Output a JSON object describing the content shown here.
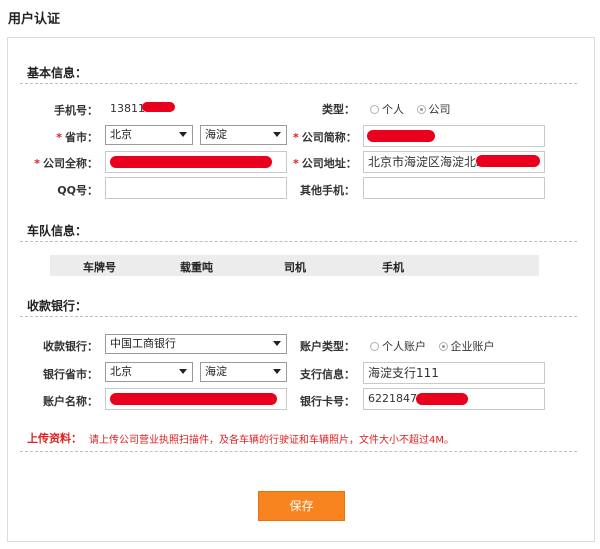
{
  "page_title": "用户认证",
  "basic": {
    "section_title": "基本信息：",
    "phone_label": "手机号：",
    "phone_value": "138118",
    "type_label": "类型：",
    "type_options": [
      "个人",
      "公司"
    ],
    "type_selected": "公司",
    "province_label": "省市：",
    "province_value": "北京",
    "city_value": "海淀",
    "short_name_label": "公司简称：",
    "short_name_value": "",
    "full_name_label": "公司全称：",
    "full_name_value": "",
    "address_label": "公司地址：",
    "address_value": "北京市海淀区海淀北二",
    "qq_label": "QQ号：",
    "qq_value": "",
    "other_phone_label": "其他手机：",
    "other_phone_value": "",
    "required_mark": "*"
  },
  "fleet": {
    "section_title": "车队信息：",
    "columns": [
      "车牌号",
      "载重吨",
      "司机",
      "手机"
    ]
  },
  "bank": {
    "section_title": "收款银行：",
    "bank_label": "收款银行：",
    "bank_value": "中国工商银行",
    "account_type_label": "账户类型：",
    "account_type_options": [
      "个人账户",
      "企业账户"
    ],
    "account_type_selected": "企业账户",
    "bank_province_label": "银行省市：",
    "bank_province_value": "北京",
    "bank_city_value": "海淀",
    "branch_label": "支行信息：",
    "branch_value": "海淀支行111",
    "account_name_label": "账户名称：",
    "account_name_value": "",
    "card_label": "银行卡号：",
    "card_value": "622184738"
  },
  "upload": {
    "label": "上传资料：",
    "hint": "请上传公司营业执照扫描件，及各车辆的行驶证和车辆照片，文件大小不超过4M。"
  },
  "save_label": "保存",
  "colors": {
    "accent": "#f7841f",
    "required": "#e02020",
    "redaction": "#e8001c"
  }
}
